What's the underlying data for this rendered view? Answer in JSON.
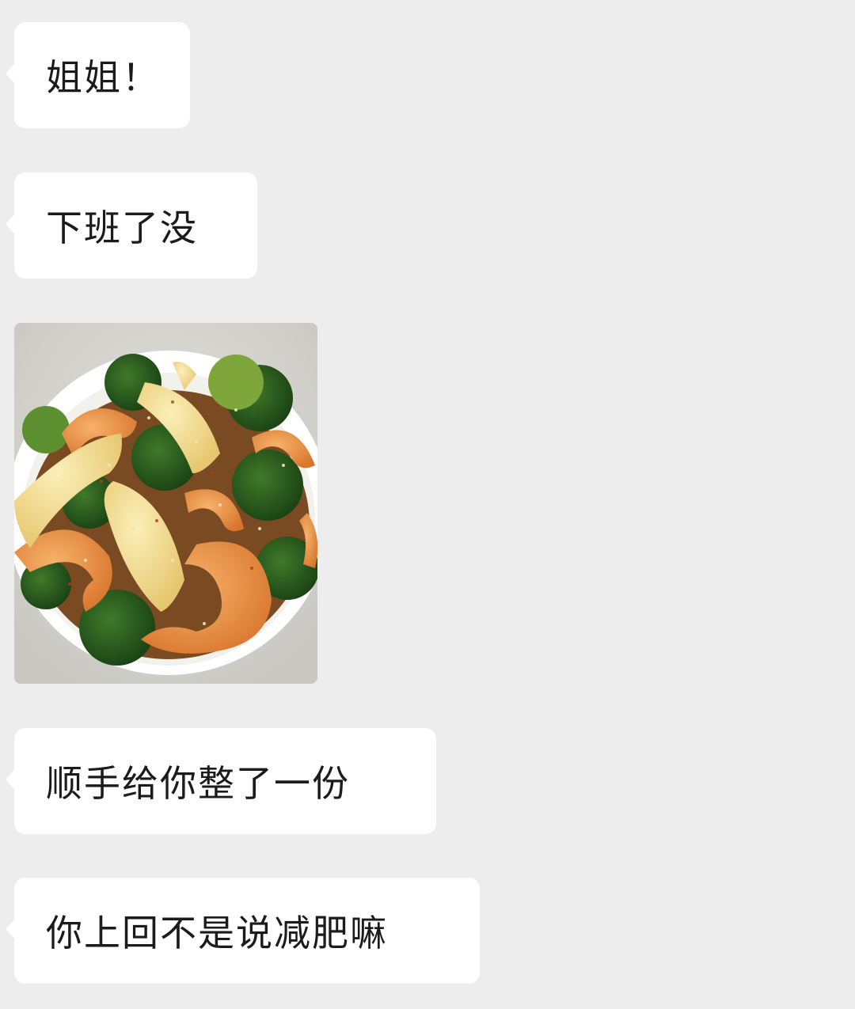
{
  "messages": [
    {
      "type": "text",
      "text": "姐姐！"
    },
    {
      "type": "text",
      "text": "下班了没"
    },
    {
      "type": "image",
      "content": "salad-bowl-photo"
    },
    {
      "type": "text",
      "text": "顺手给你整了一份"
    },
    {
      "type": "text",
      "text": "你上回不是说减肥嘛"
    }
  ],
  "colors": {
    "background": "#ededed",
    "bubble": "#ffffff",
    "text": "#1b1b1b"
  }
}
